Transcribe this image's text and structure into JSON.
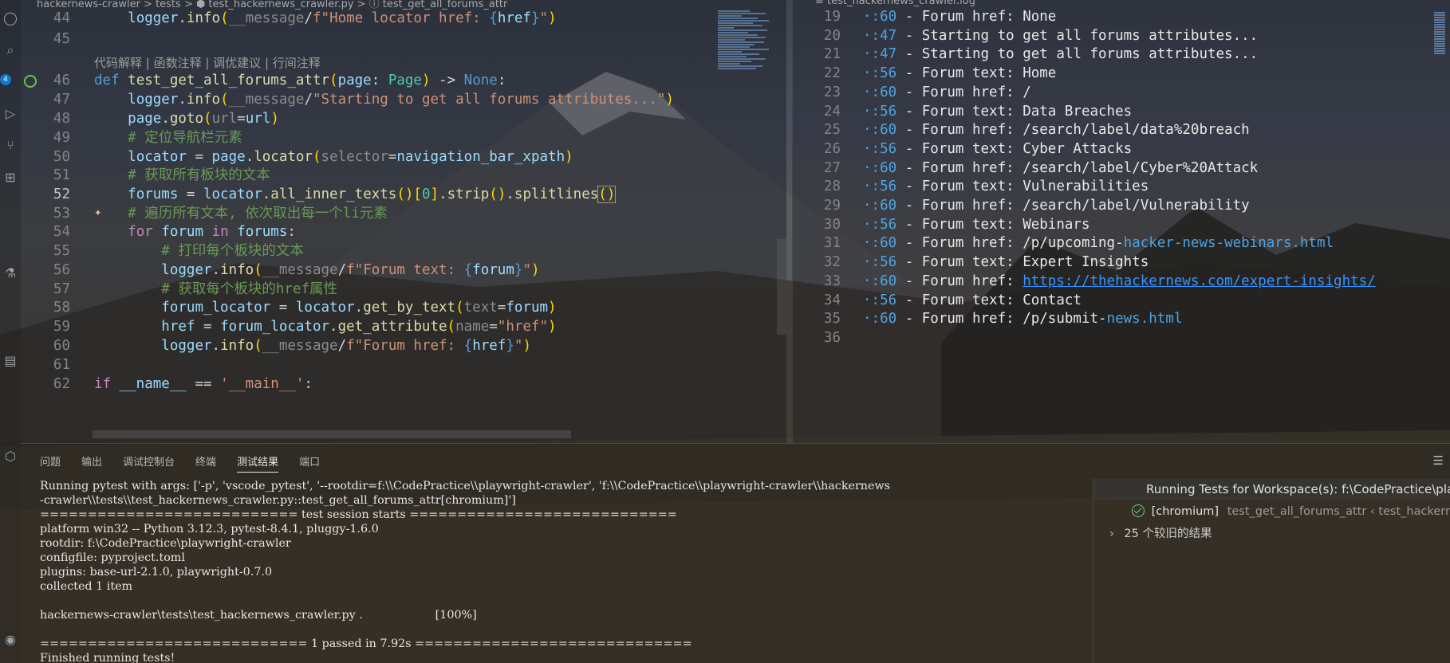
{
  "editor": {
    "breadcrumb": "hackernews-crawler  >  tests  >  ⬢  test_hackernews_crawler.py  >  ⓘ  test_get_all_forums_attr",
    "codelens": "代码解释 | 函数注释 | 调优建议 | 行间注释",
    "lines": [
      {
        "n": "44",
        "segs": [
          [
            "    ",
            ""
          ],
          [
            "logger",
            "v"
          ],
          [
            ".",
            ""
          ],
          [
            "info",
            "f"
          ],
          [
            "(",
            "b1"
          ],
          [
            "__message",
            "p"
          ],
          [
            "/",
            ""
          ],
          [
            "f\"Home locator href: ",
            "s"
          ],
          [
            "{",
            "k"
          ],
          [
            "href",
            "v"
          ],
          [
            "}",
            "k"
          ],
          [
            "\"",
            "s"
          ],
          [
            ")",
            "b1"
          ]
        ]
      },
      {
        "n": "45",
        "segs": []
      },
      {
        "n": "46",
        "segs": [
          [
            "def ",
            "k"
          ],
          [
            "test_get_all_forums_attr",
            "f"
          ],
          [
            "(",
            "b1"
          ],
          [
            "page",
            "v"
          ],
          [
            ": ",
            ""
          ],
          [
            "Page",
            "t"
          ],
          [
            ")",
            "b1"
          ],
          [
            " -> ",
            ""
          ],
          [
            "None",
            "k"
          ],
          [
            ":",
            ""
          ]
        ]
      },
      {
        "n": "47",
        "segs": [
          [
            "    ",
            ""
          ],
          [
            "logger",
            "v"
          ],
          [
            ".",
            ""
          ],
          [
            "info",
            "f"
          ],
          [
            "(",
            "b1"
          ],
          [
            "__message",
            "p"
          ],
          [
            "/",
            ""
          ],
          [
            "\"Starting to get all forums attributes...\"",
            "s"
          ],
          [
            ")",
            "b1"
          ]
        ]
      },
      {
        "n": "48",
        "segs": [
          [
            "    ",
            ""
          ],
          [
            "page",
            "v"
          ],
          [
            ".",
            ""
          ],
          [
            "goto",
            "f"
          ],
          [
            "(",
            "b1"
          ],
          [
            "url",
            "p"
          ],
          [
            "=",
            ""
          ],
          [
            "url",
            "v"
          ],
          [
            ")",
            "b1"
          ]
        ]
      },
      {
        "n": "49",
        "segs": [
          [
            "    ",
            ""
          ],
          [
            "# 定位导航栏元素",
            "c"
          ]
        ]
      },
      {
        "n": "50",
        "segs": [
          [
            "    ",
            ""
          ],
          [
            "locator",
            "v"
          ],
          [
            " = ",
            ""
          ],
          [
            "page",
            "v"
          ],
          [
            ".",
            ""
          ],
          [
            "locator",
            "f"
          ],
          [
            "(",
            "b1"
          ],
          [
            "selector",
            "p"
          ],
          [
            "=",
            ""
          ],
          [
            "navigation_bar_xpath",
            "v"
          ],
          [
            ")",
            "b1"
          ]
        ]
      },
      {
        "n": "51",
        "segs": [
          [
            "    ",
            ""
          ],
          [
            "# 获取所有板块的文本",
            "c"
          ]
        ]
      },
      {
        "n": "52",
        "segs": [
          [
            "    ",
            ""
          ],
          [
            "forums",
            "v"
          ],
          [
            " = ",
            ""
          ],
          [
            "locator",
            "v"
          ],
          [
            ".",
            ""
          ],
          [
            "all_inner_texts",
            "f"
          ],
          [
            "()",
            "b1"
          ],
          [
            "[",
            "b1"
          ],
          [
            "0",
            "t"
          ],
          [
            "]",
            "b1"
          ],
          [
            ".",
            ""
          ],
          [
            "strip",
            "f"
          ],
          [
            "()",
            "b1"
          ],
          [
            ".",
            ""
          ],
          [
            "splitlines",
            "f"
          ],
          [
            "()",
            "cursor"
          ]
        ]
      },
      {
        "n": "53",
        "segs": [
          [
            "    ",
            ""
          ],
          [
            "# 遍历所有文本, 依次取出每一个li元素",
            "c"
          ]
        ]
      },
      {
        "n": "54",
        "segs": [
          [
            "    ",
            ""
          ],
          [
            "for ",
            "kc"
          ],
          [
            "forum",
            "v"
          ],
          [
            " in ",
            "kc"
          ],
          [
            "forums",
            "v"
          ],
          [
            ":",
            ""
          ]
        ]
      },
      {
        "n": "55",
        "segs": [
          [
            "        ",
            ""
          ],
          [
            "# 打印每个板块的文本",
            "c"
          ]
        ]
      },
      {
        "n": "56",
        "segs": [
          [
            "        ",
            ""
          ],
          [
            "logger",
            "v"
          ],
          [
            ".",
            ""
          ],
          [
            "info",
            "f"
          ],
          [
            "(",
            "b1"
          ],
          [
            "__message",
            "p"
          ],
          [
            "/",
            ""
          ],
          [
            "f\"Forum text: ",
            "s"
          ],
          [
            "{",
            "k"
          ],
          [
            "forum",
            "v"
          ],
          [
            "}",
            "k"
          ],
          [
            "\"",
            "s"
          ],
          [
            ")",
            "b1"
          ]
        ]
      },
      {
        "n": "57",
        "segs": [
          [
            "        ",
            ""
          ],
          [
            "# 获取每个板块的href属性",
            "c"
          ]
        ]
      },
      {
        "n": "58",
        "segs": [
          [
            "        ",
            ""
          ],
          [
            "forum_locator",
            "v"
          ],
          [
            " = ",
            ""
          ],
          [
            "locator",
            "v"
          ],
          [
            ".",
            ""
          ],
          [
            "get_by_text",
            "f"
          ],
          [
            "(",
            "b1"
          ],
          [
            "text",
            "p"
          ],
          [
            "=",
            ""
          ],
          [
            "forum",
            "v"
          ],
          [
            ")",
            "b1"
          ]
        ]
      },
      {
        "n": "59",
        "segs": [
          [
            "        ",
            ""
          ],
          [
            "href",
            "v"
          ],
          [
            " = ",
            ""
          ],
          [
            "forum_locator",
            "v"
          ],
          [
            ".",
            ""
          ],
          [
            "get_attribute",
            "f"
          ],
          [
            "(",
            "b1"
          ],
          [
            "name",
            "p"
          ],
          [
            "=",
            ""
          ],
          [
            "\"href\"",
            "s"
          ],
          [
            ")",
            "b1"
          ]
        ]
      },
      {
        "n": "60",
        "segs": [
          [
            "        ",
            ""
          ],
          [
            "logger",
            "v"
          ],
          [
            ".",
            ""
          ],
          [
            "info",
            "f"
          ],
          [
            "(",
            "b1"
          ],
          [
            "__message",
            "p"
          ],
          [
            "/",
            ""
          ],
          [
            "f\"Forum href: ",
            "s"
          ],
          [
            "{",
            "k"
          ],
          [
            "href",
            "v"
          ],
          [
            "}",
            "k"
          ],
          [
            "\"",
            "s"
          ],
          [
            ")",
            "b1"
          ]
        ]
      },
      {
        "n": "61",
        "segs": []
      },
      {
        "n": "62",
        "segs": [
          [
            "if ",
            "kc"
          ],
          [
            "__name__",
            "v"
          ],
          [
            " == ",
            ""
          ],
          [
            "'__main__'",
            "s"
          ],
          [
            ":",
            ""
          ]
        ]
      }
    ]
  },
  "log": {
    "title": "≡  test_hackernews_crawler.log",
    "lines": [
      {
        "n": "19",
        "t": "·:60 - Forum href: None"
      },
      {
        "n": "20",
        "t": "·:47 - Starting to get all forums attributes..."
      },
      {
        "n": "21",
        "t": "·:47 - Starting to get all forums attributes..."
      },
      {
        "n": "22",
        "t": "·:56 - Forum text: Home"
      },
      {
        "n": "23",
        "t": "·:60 - Forum href: /"
      },
      {
        "n": "24",
        "t": "·:56 - Forum text: Data Breaches"
      },
      {
        "n": "25",
        "t": "·:60 - Forum href: /search/label/data%20breach"
      },
      {
        "n": "26",
        "t": "·:56 - Forum text: Cyber Attacks"
      },
      {
        "n": "27",
        "t": "·:60 - Forum href: /search/label/Cyber%20Attack"
      },
      {
        "n": "28",
        "t": "·:56 - Forum text: Vulnerabilities"
      },
      {
        "n": "29",
        "t": "·:60 - Forum href: /search/label/Vulnerability"
      },
      {
        "n": "30",
        "t": "·:56 - Forum text: Webinars"
      },
      {
        "n": "31",
        "t": "·:60 - Forum href: /p/upcoming-",
        "hl": "hacker-news-webinars.html"
      },
      {
        "n": "32",
        "t": "·:56 - Forum text: Expert Insights"
      },
      {
        "n": "33",
        "t": "·:60 - Forum href: ",
        "link": "https://thehackernews.com/expert-insights/"
      },
      {
        "n": "34",
        "t": "·:56 - Forum text: Contact"
      },
      {
        "n": "35",
        "t": "·:60 - Forum href: /p/submit-",
        "hl": "news.html"
      },
      {
        "n": "36",
        "t": ""
      }
    ]
  },
  "panel": {
    "tabs": [
      "问题",
      "输出",
      "调试控制台",
      "终端",
      "测试结果",
      "端口"
    ],
    "active_tab": "测试结果",
    "terminal": [
      "Running pytest with args: ['-p', 'vscode_pytest', '--rootdir=f:\\\\CodePractice\\\\playwright-crawler', 'f:\\\\CodePractice\\\\playwright-crawler\\\\hackernews",
      "-crawler\\\\tests\\\\test_hackernews_crawler.py::test_get_all_forums_attr[chromium]']",
      "=========================== test session starts ============================",
      "platform win32 -- Python 3.12.3, pytest-8.4.1, pluggy-1.6.0",
      "rootdir: f:\\CodePractice\\playwright-crawler",
      "configfile: pyproject.toml",
      "plugins: base-url-2.1.0, playwright-0.7.0",
      "collected 1 item",
      "",
      "hackernews-crawler\\tests\\test_hackernews_crawler.py .                    [100%]",
      "",
      "============================ 1 passed in 7.92s =============================",
      "Finished running tests!"
    ],
    "test_results": {
      "header": "Running Tests for Workspace(s): f:\\CodePractice\\playwright-crawler",
      "pass_label": "[chromium]",
      "pass_detail": "test_get_all_forums_attr ‹ test_hackernews_crawler.py",
      "older": "25 个较旧的结果"
    }
  }
}
